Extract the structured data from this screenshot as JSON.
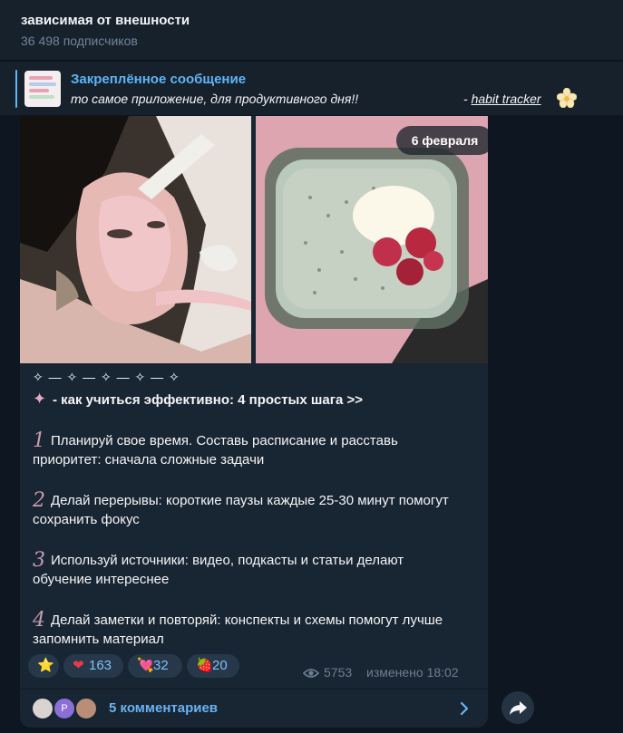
{
  "header": {
    "title": "зависимая от внешности",
    "subscribers": "36 498 подписчиков"
  },
  "pinned": {
    "title": "Закреплённое сообщение",
    "text": "то самое приложение, для продуктивного дня!!",
    "link_prefix": "- ",
    "link_text": "habit tracker",
    "icon": "flower-icon"
  },
  "message": {
    "date": "6 февраля",
    "divider": "✧ — ✧ — ✧ — ✧ — ✧",
    "heading": "- как учиться эффективно: 4 простых шага >>",
    "steps": [
      {
        "num": "1",
        "text": "Планируй свое время. Составь расписание и расставь приоритет: сначала сложные задачи"
      },
      {
        "num": "2",
        "text": "Делай перерывы: короткие паузы каждые 25-30 минут помогут сохранить фокус"
      },
      {
        "num": "3",
        "text": "Используй источники: видео, подкасты и статьи делают обучение интереснее"
      },
      {
        "num": "4",
        "text": "Делай заметки и повторяй: конспекты и схемы помогут лучше запомнить материал"
      }
    ],
    "reactions": [
      {
        "emoji": "⭐",
        "count": ""
      },
      {
        "emoji": "❤",
        "count": "163"
      },
      {
        "emoji": "💘",
        "count": "32"
      },
      {
        "emoji": "🍓",
        "count": "20"
      }
    ],
    "views": "5753",
    "edited": "изменено 18:02",
    "comments": "5 комментариев",
    "avatar_letter": "P"
  },
  "colors": {
    "background": "#0e1621",
    "bubble": "#182533",
    "accent": "#5eb5f7"
  }
}
